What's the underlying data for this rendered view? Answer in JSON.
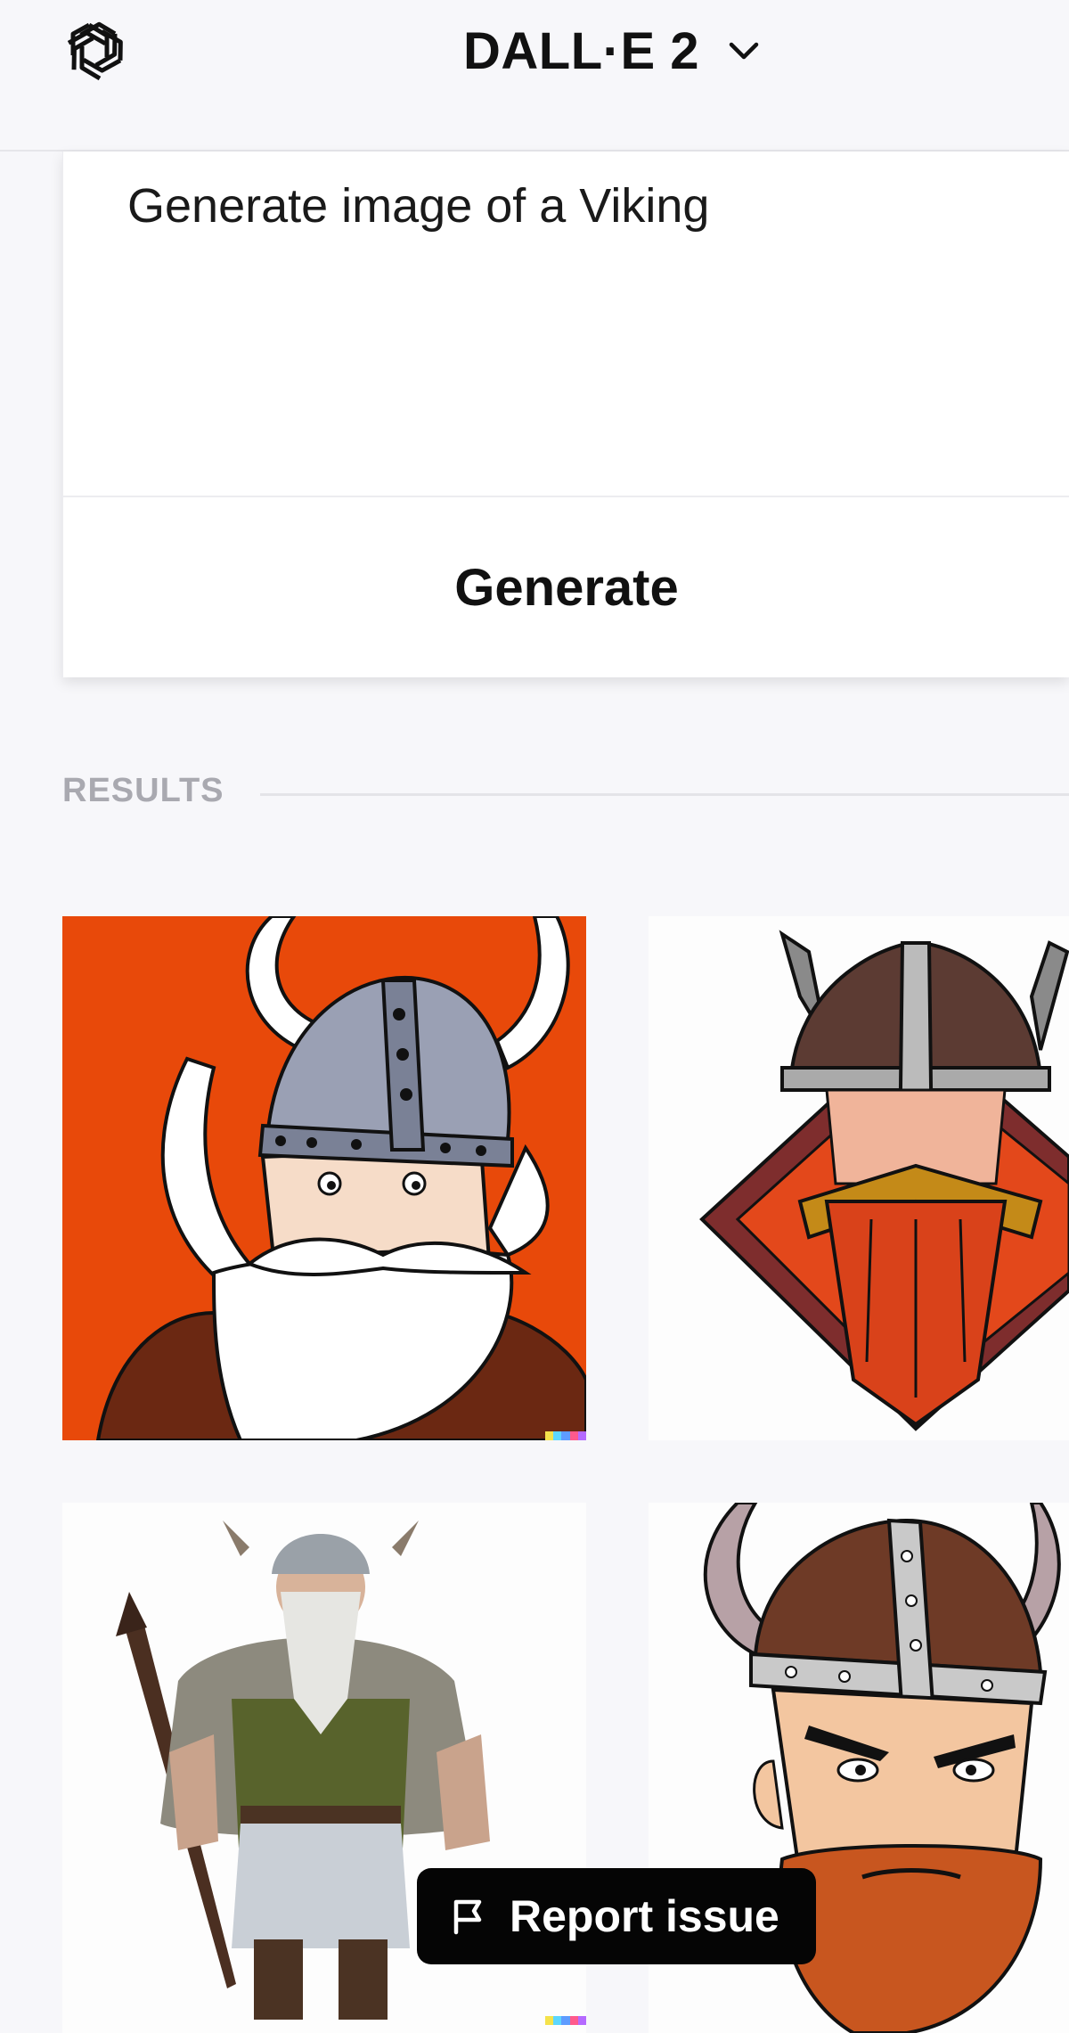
{
  "header": {
    "title": "DALL·E 2",
    "logo_icon": "openai-logo-icon",
    "chevron_icon": "chevron-down-icon"
  },
  "prompt": {
    "text": "Generate image of a Viking"
  },
  "actions": {
    "generate_label": "Generate",
    "report_label": "Report issue",
    "report_icon": "flag-icon"
  },
  "results": {
    "heading": "RESULTS",
    "images": [
      {
        "style": "cartoon viking, grey studded helmet, white beard",
        "background": "#e8490a"
      },
      {
        "style": "diamond emblem viking, red beard, horned helmet",
        "background": "#fdfdfd"
      },
      {
        "style": "3d viking warrior with spear, fur cloak",
        "background": "#fdfdfd"
      },
      {
        "style": "drawn angry viking, horned helmet, red beard",
        "background": "#fdfdfd"
      }
    ]
  },
  "colors": {
    "accent_dark": "#050505",
    "results_heading": "#a9a9b0",
    "page_bg": "#f7f7fa",
    "signature": [
      "#f5e24b",
      "#5cd7ff",
      "#5e9cff",
      "#ff5a8c",
      "#b56aff"
    ]
  }
}
